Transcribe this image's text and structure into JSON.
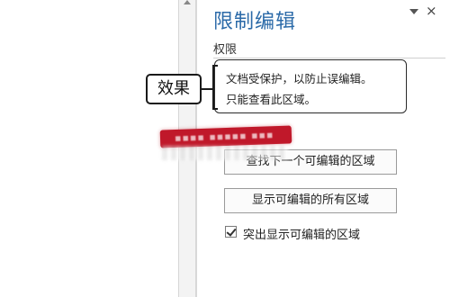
{
  "pane": {
    "title": "限制编辑",
    "section_label": "权限",
    "info_line1": "文档受保护，以防止误编辑。",
    "info_line2": "只能查看此区域。",
    "find_next_button": "查找下一个可编辑的区域",
    "show_all_button": "显示可编辑的所有区域",
    "highlight_checkbox_label": "突出显示可编辑的区域",
    "highlight_checked": true,
    "close_glyph": "×"
  },
  "callout": {
    "label": "效果"
  },
  "colors": {
    "title_blue": "#2b6aa8",
    "stamp_red": "#c0182a"
  },
  "icons": [
    "pane-dropdown-icon",
    "close-icon",
    "scroll-up-icon",
    "checkmark-icon"
  ]
}
